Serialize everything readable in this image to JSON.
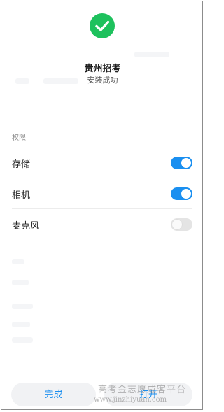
{
  "header": {
    "app_name": "贵州招考",
    "status": "安装成功"
  },
  "permissions": {
    "section_title": "权限",
    "items": [
      {
        "label": "存储",
        "enabled": true
      },
      {
        "label": "相机",
        "enabled": true
      },
      {
        "label": "麦克风",
        "enabled": false
      }
    ]
  },
  "footer": {
    "done_label": "完成",
    "open_label": "打开"
  },
  "watermark": {
    "text": "高考金志愿咸客平台",
    "url": "www.jinzhiyuan.com"
  },
  "colors": {
    "accent": "#1a8ff0",
    "success": "#1ec15d",
    "toggle_off": "#e4e4e4"
  },
  "icons": {
    "status": "check-circle-icon"
  }
}
